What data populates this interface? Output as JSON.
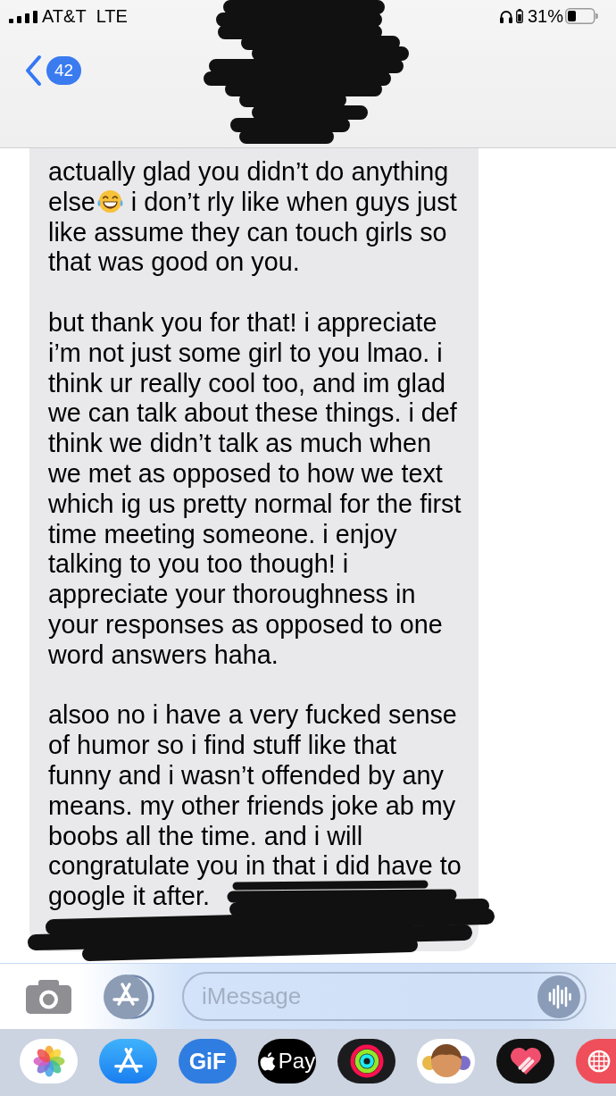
{
  "status_bar": {
    "carrier": "AT&T",
    "network": "LTE",
    "battery_percent": "31%"
  },
  "header": {
    "unread_count": "42"
  },
  "message": {
    "paragraphs": [
      {
        "lines": [
          [
            {
              "kind": "text",
              "text": "actually glad you didn’t do anything"
            }
          ],
          [
            {
              "kind": "text",
              "text": "else"
            },
            {
              "kind": "emoji"
            },
            {
              "kind": "text",
              "text": "i don’t rly like when guys just"
            }
          ],
          [
            {
              "kind": "text",
              "text": "like assume they can touch girls so that was good on you."
            }
          ]
        ]
      },
      {
        "lines": [
          [
            {
              "kind": "text",
              "text": "but thank you for that! i appreciate i’m not just some girl to you lmao. i think ur really cool too, and im glad we can talk about these things. i def think we didn’t talk as much when we met as opposed to how we text which ig us pretty normal for the first time meeting someone. i enjoy talking to you too though! i appreciate your thoroughness in your responses as opposed to one word answers haha."
            }
          ]
        ]
      },
      {
        "lines": [
          [
            {
              "kind": "text",
              "text": "alsoo no i have a very fucked sense of humor so i find stuff like that funny and i wasn’t offended by any means. my other friends joke ab my boobs all the time. and i will congratulate you in that i did have to google it after."
            }
          ]
        ]
      }
    ]
  },
  "compose": {
    "placeholder": "iMessage"
  },
  "app_drawer": {
    "apps": [
      {
        "kind": "photos"
      },
      {
        "kind": "apps"
      },
      {
        "kind": "gif",
        "label": "GiF"
      },
      {
        "kind": "pay",
        "label": "Pay"
      },
      {
        "kind": "activity"
      },
      {
        "kind": "stickers"
      },
      {
        "kind": "touch"
      },
      {
        "kind": "web"
      }
    ]
  }
}
